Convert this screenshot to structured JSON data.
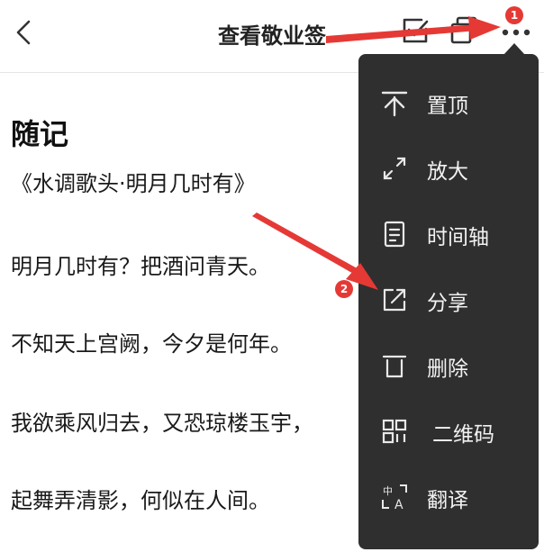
{
  "header": {
    "title": "查看敬业签"
  },
  "note": {
    "heading": "随记",
    "lines": [
      "《水调歌头·明月几时有》",
      "明月几时有？把酒问青天。",
      "不知天上宫阙，今夕是何年。",
      "我欲乘风归去，又恐琼楼玉宇，",
      "起舞弄清影，何似在人间。"
    ]
  },
  "menu": {
    "items": [
      {
        "label": "置顶",
        "icon": "pin-top-icon"
      },
      {
        "label": "放大",
        "icon": "expand-icon"
      },
      {
        "label": "时间轴",
        "icon": "timeline-icon"
      },
      {
        "label": "分享",
        "icon": "share-icon"
      },
      {
        "label": "删除",
        "icon": "trash-icon"
      },
      {
        "label": "二维码",
        "icon": "qr-code-icon"
      },
      {
        "label": "翻译",
        "icon": "translate-icon"
      }
    ]
  },
  "annotations": {
    "badge_1": "1",
    "badge_2": "2",
    "arrow_color": "#e53935"
  },
  "colors": {
    "menu_bg": "#2f2f2f",
    "menu_text": "#f2f2f2",
    "badge": "#e53935"
  }
}
